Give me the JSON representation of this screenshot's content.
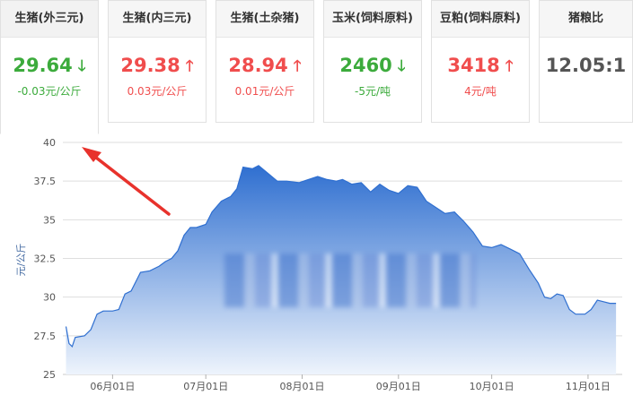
{
  "cards": [
    {
      "title": "生猪(外三元)",
      "price": "29.64",
      "direction": "down",
      "arrow": "🡓",
      "change": "-0.03元/公斤"
    },
    {
      "title": "生猪(内三元)",
      "price": "29.38",
      "direction": "up",
      "arrow": "🡑",
      "change": "0.03元/公斤"
    },
    {
      "title": "生猪(土杂猪)",
      "price": "28.94",
      "direction": "up",
      "arrow": "🡑",
      "change": "0.01元/公斤"
    },
    {
      "title": "玉米(饲料原料)",
      "price": "2460",
      "direction": "down",
      "arrow": "🡓",
      "change": "-5元/吨"
    },
    {
      "title": "豆粕(饲料原料)",
      "price": "3418",
      "direction": "up",
      "arrow": "🡑",
      "change": "4元/吨"
    },
    {
      "title": "猪粮比",
      "price": "12.05:1",
      "direction": "neutral",
      "arrow": "",
      "change": ""
    }
  ],
  "colors": {
    "up": "#f04d4d",
    "down": "#3cab3c",
    "area_top": "#2f6fd0",
    "area_bottom": "#eef4fc",
    "line": "#2f6fd0",
    "annotation_arrow": "#e8322c"
  },
  "chart_data": {
    "type": "area",
    "ylabel": "元/公斤",
    "ylim": [
      25,
      40
    ],
    "yticks": [
      25,
      27.5,
      30,
      32.5,
      35,
      37.5,
      40
    ],
    "ytick_labels": [
      "25",
      "27.5",
      "30",
      "32.5",
      "35",
      "37.5",
      "40"
    ],
    "xticks": [
      {
        "date": "2021-06-01",
        "label": "06月01日"
      },
      {
        "date": "2021-07-01",
        "label": "07月01日"
      },
      {
        "date": "2021-08-01",
        "label": "08月01日"
      },
      {
        "date": "2021-09-01",
        "label": "09月01日"
      },
      {
        "date": "2021-10-01",
        "label": "10月01日"
      },
      {
        "date": "2021-11-01",
        "label": "11月01日"
      }
    ],
    "xlim": [
      "2021-05-16",
      "2021-11-12"
    ],
    "grid": true,
    "series": [
      {
        "points": [
          [
            "2021-05-17",
            28.1
          ],
          [
            "2021-05-18",
            27.0
          ],
          [
            "2021-05-19",
            26.8
          ],
          [
            "2021-05-20",
            27.4
          ],
          [
            "2021-05-23",
            27.5
          ],
          [
            "2021-05-25",
            27.9
          ],
          [
            "2021-05-27",
            28.9
          ],
          [
            "2021-05-29",
            29.1
          ],
          [
            "2021-06-01",
            29.1
          ],
          [
            "2021-06-03",
            29.2
          ],
          [
            "2021-06-05",
            30.2
          ],
          [
            "2021-06-07",
            30.4
          ],
          [
            "2021-06-10",
            31.6
          ],
          [
            "2021-06-13",
            31.7
          ],
          [
            "2021-06-16",
            32.0
          ],
          [
            "2021-06-18",
            32.3
          ],
          [
            "2021-06-20",
            32.5
          ],
          [
            "2021-06-22",
            33.0
          ],
          [
            "2021-06-24",
            34.0
          ],
          [
            "2021-06-26",
            34.5
          ],
          [
            "2021-06-28",
            34.5
          ],
          [
            "2021-07-01",
            34.7
          ],
          [
            "2021-07-03",
            35.5
          ],
          [
            "2021-07-06",
            36.2
          ],
          [
            "2021-07-09",
            36.5
          ],
          [
            "2021-07-11",
            37.0
          ],
          [
            "2021-07-13",
            38.4
          ],
          [
            "2021-07-16",
            38.3
          ],
          [
            "2021-07-18",
            38.5
          ],
          [
            "2021-07-21",
            38.0
          ],
          [
            "2021-07-24",
            37.5
          ],
          [
            "2021-07-27",
            37.5
          ],
          [
            "2021-07-31",
            37.4
          ],
          [
            "2021-08-03",
            37.6
          ],
          [
            "2021-08-06",
            37.8
          ],
          [
            "2021-08-09",
            37.6
          ],
          [
            "2021-08-12",
            37.5
          ],
          [
            "2021-08-14",
            37.6
          ],
          [
            "2021-08-17",
            37.3
          ],
          [
            "2021-08-20",
            37.4
          ],
          [
            "2021-08-23",
            36.8
          ],
          [
            "2021-08-26",
            37.3
          ],
          [
            "2021-08-29",
            36.9
          ],
          [
            "2021-09-01",
            36.7
          ],
          [
            "2021-09-04",
            37.2
          ],
          [
            "2021-09-07",
            37.1
          ],
          [
            "2021-09-10",
            36.2
          ],
          [
            "2021-09-13",
            35.8
          ],
          [
            "2021-09-16",
            35.4
          ],
          [
            "2021-09-19",
            35.5
          ],
          [
            "2021-09-22",
            34.9
          ],
          [
            "2021-09-25",
            34.2
          ],
          [
            "2021-09-28",
            33.3
          ],
          [
            "2021-10-01",
            33.2
          ],
          [
            "2021-10-04",
            33.4
          ],
          [
            "2021-10-07",
            33.1
          ],
          [
            "2021-10-10",
            32.8
          ],
          [
            "2021-10-13",
            31.8
          ],
          [
            "2021-10-16",
            30.9
          ],
          [
            "2021-10-18",
            30.0
          ],
          [
            "2021-10-20",
            29.9
          ],
          [
            "2021-10-22",
            30.2
          ],
          [
            "2021-10-24",
            30.1
          ],
          [
            "2021-10-26",
            29.2
          ],
          [
            "2021-10-28",
            28.9
          ],
          [
            "2021-10-31",
            28.9
          ],
          [
            "2021-11-02",
            29.2
          ],
          [
            "2021-11-04",
            29.8
          ],
          [
            "2021-11-06",
            29.7
          ],
          [
            "2021-11-08",
            29.6
          ],
          [
            "2021-11-10",
            29.6
          ]
        ]
      }
    ]
  }
}
